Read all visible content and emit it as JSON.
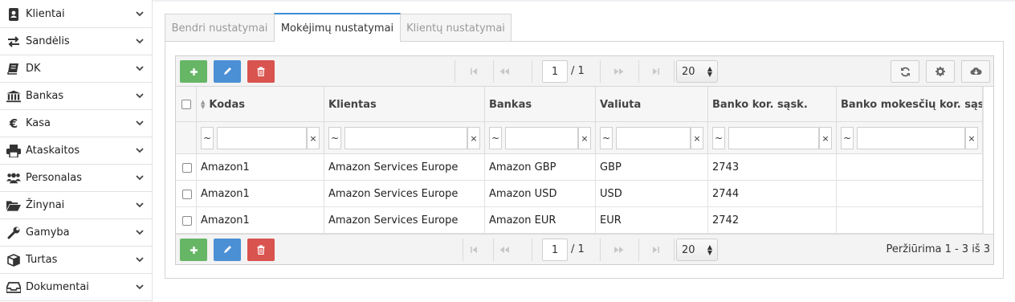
{
  "sidebar": {
    "items": [
      {
        "label": "Klientai",
        "icon": "address-book-icon"
      },
      {
        "label": "Sandėlis",
        "icon": "exchange-icon"
      },
      {
        "label": "DK",
        "icon": "book-icon"
      },
      {
        "label": "Bankas",
        "icon": "bank-icon"
      },
      {
        "label": "Kasa",
        "icon": "euro-icon"
      },
      {
        "label": "Ataskaitos",
        "icon": "print-icon"
      },
      {
        "label": "Personalas",
        "icon": "users-icon"
      },
      {
        "label": "Žinynai",
        "icon": "folder-open-icon"
      },
      {
        "label": "Gamyba",
        "icon": "wrench-icon"
      },
      {
        "label": "Turtas",
        "icon": "cube-icon"
      },
      {
        "label": "Dokumentai",
        "icon": "inbox-icon"
      }
    ]
  },
  "tabs": [
    {
      "label": "Bendri nustatymai",
      "active": false
    },
    {
      "label": "Mokėjimų nustatymai",
      "active": true
    },
    {
      "label": "Klientų nustatymai",
      "active": false
    }
  ],
  "pager": {
    "page": "1",
    "total": "/ 1",
    "page_size": "20",
    "records_text": "Peržiūrima 1 - 3 iš 3"
  },
  "columns": [
    "Kodas",
    "Klientas",
    "Bankas",
    "Valiuta",
    "Banko kor. sąsk.",
    "Banko mokesčių kor. sąsk."
  ],
  "filter": {
    "op": "~",
    "clear": "×"
  },
  "rows": [
    [
      "Amazon1",
      "Amazon Services Europe",
      "Amazon GBP",
      "GBP",
      "2743",
      ""
    ],
    [
      "Amazon1",
      "Amazon Services Europe",
      "Amazon USD",
      "USD",
      "2744",
      ""
    ],
    [
      "Amazon1",
      "Amazon Services Europe",
      "Amazon EUR",
      "EUR",
      "2742",
      ""
    ]
  ],
  "colors": {
    "accent": "#3b8ed4",
    "add": "#66b666",
    "edit": "#4b8fd4",
    "delete": "#d9534f"
  }
}
